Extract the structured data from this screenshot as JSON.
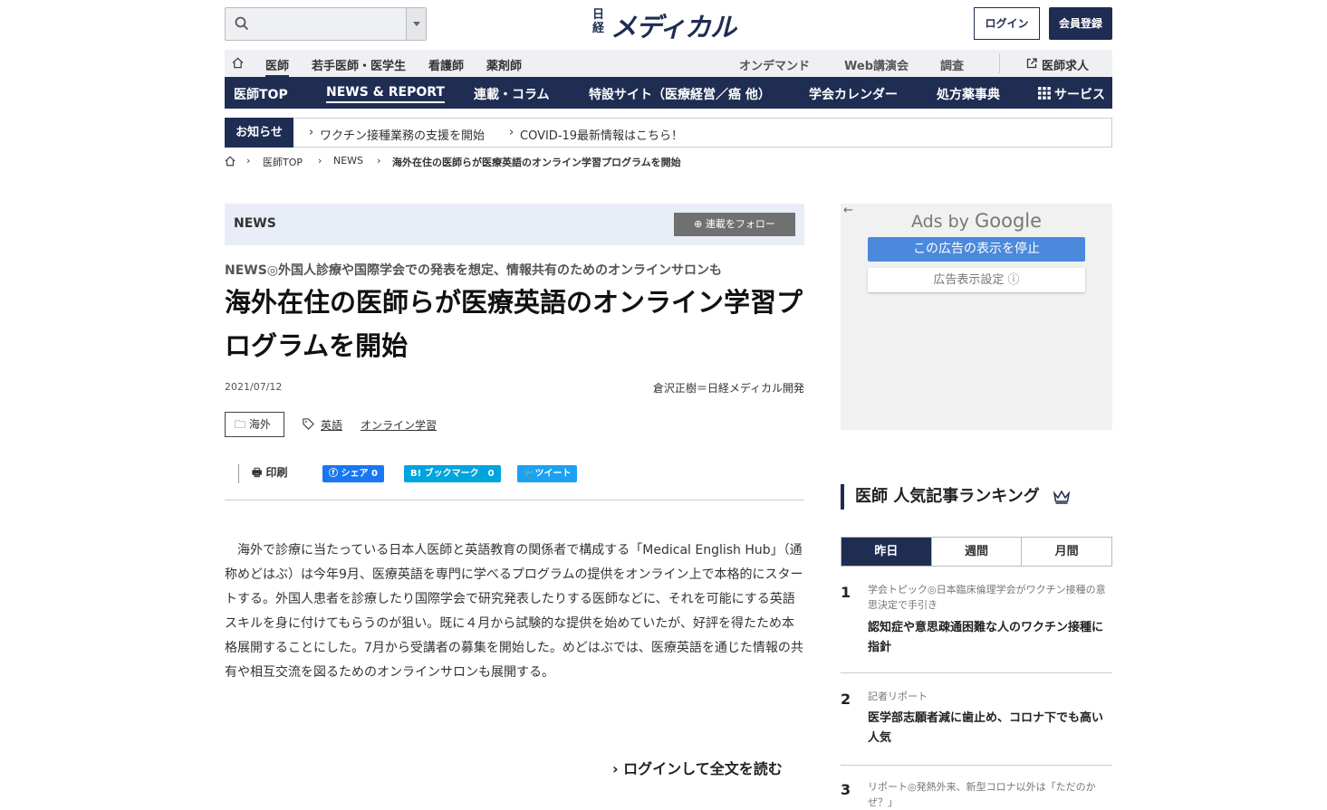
{
  "header": {
    "search_placeholder": "",
    "logo_top": "日経",
    "logo_main": "メディカル",
    "login": "ログイン",
    "register": "会員登録"
  },
  "subnav": {
    "items": [
      "医師",
      "若手医師・医学生",
      "看護師",
      "薬剤師"
    ],
    "right_items": [
      "オンデマンド",
      "Web講演会",
      "調査"
    ],
    "job": "医師求人"
  },
  "mainnav": {
    "items": [
      "医師TOP",
      "NEWS & REPORT",
      "連載・コラム",
      "特設サイト（医療経営／癌 他）",
      "学会カレンダー",
      "処方薬事典",
      "サービス"
    ]
  },
  "notice": {
    "label": "お知らせ",
    "items": [
      "ワクチン接種業務の支援を開始",
      "COVID-19最新情報はこちら！"
    ]
  },
  "breadcrumb": [
    "医師TOP",
    "NEWS",
    "海外在住の医師らが医療英語のオンライン学習プログラムを開始"
  ],
  "article": {
    "section": "NEWS",
    "follow": "連載をフォロー",
    "subtitle": "NEWS◎外国人診療や国際学会での発表を想定、情報共有のためのオンラインサロンも",
    "title": "海外在住の医師らが医療英語のオンライン学習プログラムを開始",
    "date": "2021/07/12",
    "author": "倉沢正樹＝日経メディカル開発",
    "category": "海外",
    "tags": [
      "英語",
      "オンライン学習"
    ],
    "print": "印刷",
    "share_fb": "シェア 0",
    "share_hatena": "B! ブックマーク　0",
    "share_tw": "ツイート",
    "body": "　海外で診療に当たっている日本人医師と英語教育の関係者で構成する「Medical English Hub」（通称めどはぶ）は今年9月、医療英語を専門に学べるプログラムの提供をオンライン上で本格的にスタートする。外国人患者を診療したり国際学会で研究発表したりする医師などに、それを可能にする英語スキルを身に付けてもらうのが狙い。既に４月から試験的な提供を始めていたが、好評を得たため本格展開することにした。7月から受講者の募集を開始した。めどはぶでは、医療英語を通じた情報の共有や相互交流を図るためのオンラインサロンも展開する。",
    "read_more": "ログインして全文を読む"
  },
  "ad": {
    "ads_by": "Ads by",
    "google": "Google",
    "stop": "この広告の表示を停止",
    "settings": "広告表示設定 ⓘ"
  },
  "ranking": {
    "title": "医師 人気記事ランキング",
    "tabs": [
      "昨日",
      "週間",
      "月間"
    ],
    "items": [
      {
        "num": "1",
        "cat": "学会トピック◎日本臨床倫理学会がワクチン接種の意思決定で手引き",
        "head": "認知症や意思疎通困難な人のワクチン接種に指針"
      },
      {
        "num": "2",
        "cat": "記者リポート",
        "head": "医学部志願者減に歯止め、コロナ下でも高い人気"
      },
      {
        "num": "3",
        "cat": "リポート◎発熱外来、新型コロナ以外は「ただのかぜ？」",
        "head": ""
      }
    ]
  },
  "colors": {
    "navy": "#1f2d53",
    "ad_blue": "#4a89dc",
    "facebook": "#1877f2",
    "hatena": "#00a4de",
    "twitter": "#1da1f2"
  }
}
